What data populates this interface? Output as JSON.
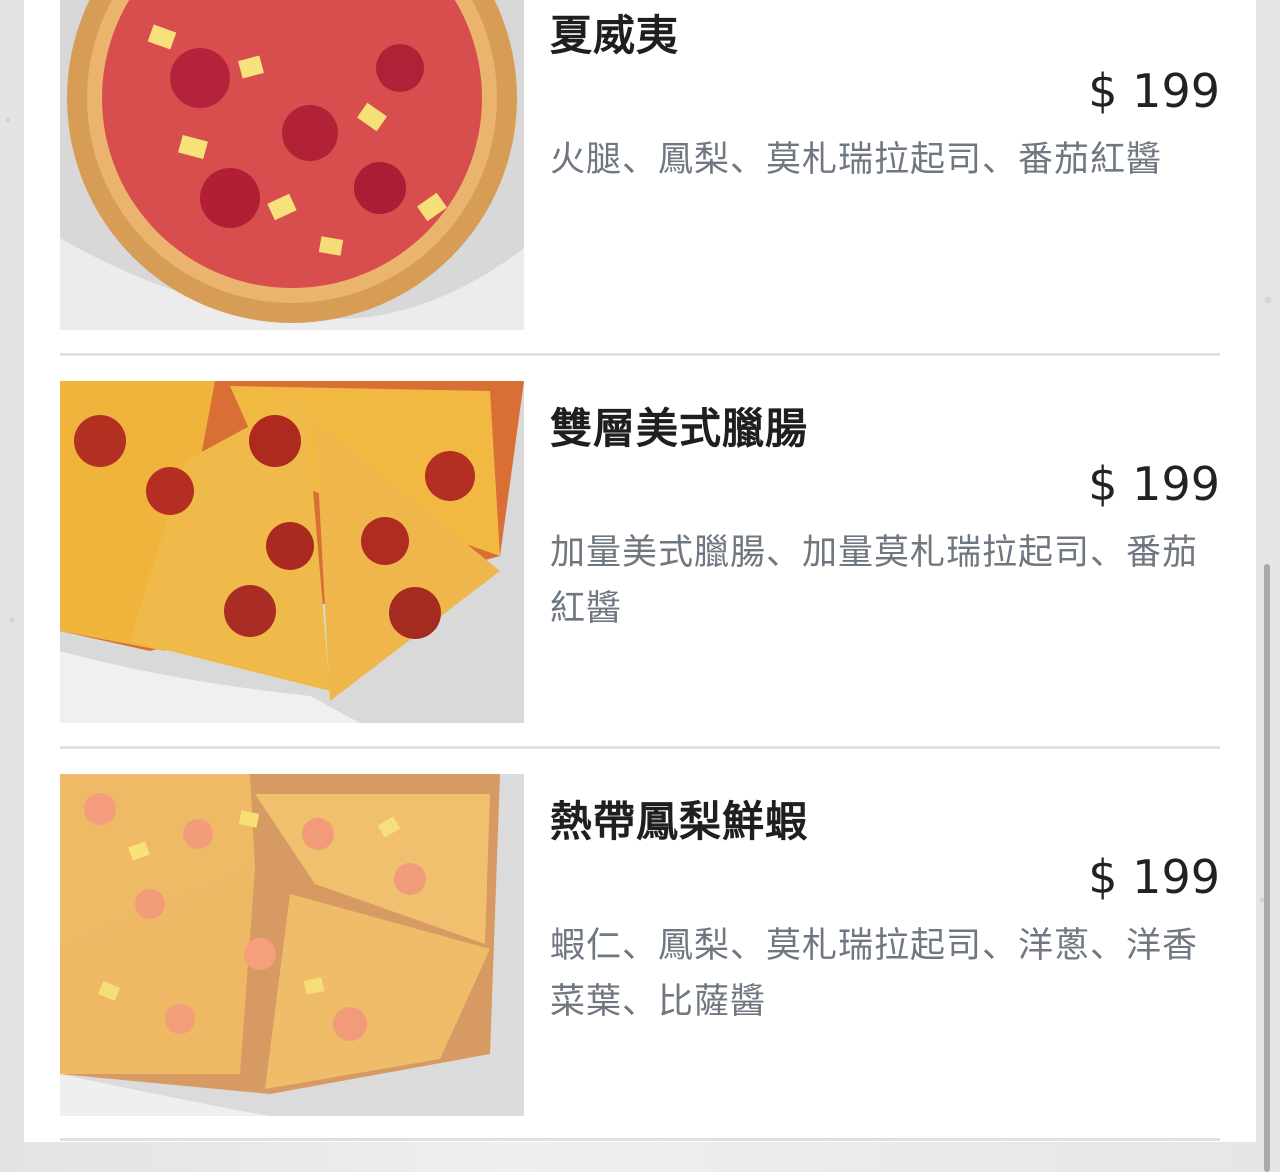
{
  "items": [
    {
      "name": "夏威夷",
      "price": "$ 199",
      "description": "火腿、鳳梨、莫札瑞拉起司、番茄紅醬",
      "image_label": "hawaiian pizza"
    },
    {
      "name": "雙層美式臘腸",
      "price": "$ 199",
      "description": "加量美式臘腸、加量莫札瑞拉起司、番茄紅醬",
      "image_label": "double pepperoni pizza"
    },
    {
      "name": "熱帶鳳梨鮮蝦",
      "price": "$ 199",
      "description": "蝦仁、鳳梨、莫札瑞拉起司、洋蔥、洋香菜葉、比薩醬",
      "image_label": "tropical pineapple shrimp pizza"
    }
  ],
  "colors": {
    "title": "#1f1f1f",
    "price": "#222222",
    "description": "#6f7781",
    "divider": "#e1e1e1"
  }
}
